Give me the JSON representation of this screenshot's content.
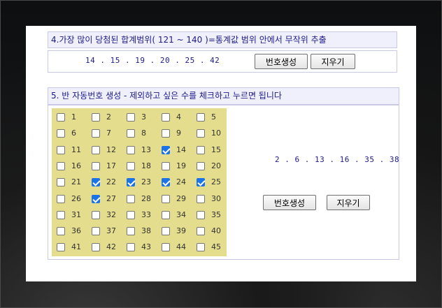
{
  "section4": {
    "title": "4.가장 많이 당첨된 합계범위( 121 ~ 140 )=통계값 범위 안에서 무작위 추출",
    "result": "14 . 15 . 19 . 20 . 25 . 42",
    "generate_label": "번호생성",
    "clear_label": "지우기"
  },
  "section5": {
    "title": "5. 반 자동번호 생성 - 제외하고 싶은 수를 체크하고 누르면 됩니다",
    "result": "2 . 6 . 13 . 16 . 35 . 38",
    "generate_label": "번호생성",
    "clear_label": "지우기",
    "numbers": [
      "1",
      "2",
      "3",
      "4",
      "5",
      "6",
      "7",
      "8",
      "9",
      "10",
      "11",
      "12",
      "13",
      "14",
      "15",
      "16",
      "17",
      "18",
      "19",
      "20",
      "21",
      "22",
      "23",
      "24",
      "25",
      "26",
      "27",
      "28",
      "29",
      "30",
      "31",
      "32",
      "33",
      "34",
      "35",
      "36",
      "37",
      "38",
      "39",
      "40",
      "41",
      "42",
      "43",
      "44",
      "45"
    ],
    "checked": [
      "14",
      "22",
      "23",
      "24",
      "25",
      "27"
    ]
  },
  "colors": {
    "title_text": "#1c1a8a",
    "title_bg": "#eff0fb",
    "grid_bg": "#e5dd8e",
    "checkbox_checked": "#1a73e8"
  },
  "icons": {
    "checkbox": "checkbox-icon"
  }
}
